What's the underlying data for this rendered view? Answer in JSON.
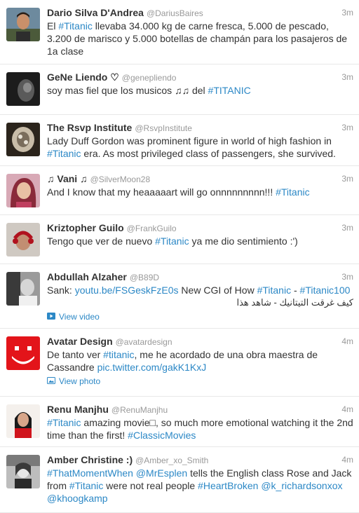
{
  "tweets": [
    {
      "name": "Dario Silva D'Andrea",
      "handle": "@DariusBaires",
      "time": "3m",
      "parts": [
        [
          "El ",
          0
        ],
        [
          "#Titanic",
          1
        ],
        [
          " llevaba 34.000 kg de carne fresca, 5.000 de pescado, 3.200 de marisco y 5.000 botellas de champán para los pasajeros de 1a clase",
          0
        ]
      ]
    },
    {
      "name": "GeNe Liendo ♡",
      "handle": "@geneplie​ndo",
      "time": "3m",
      "parts": [
        [
          "soy mas fiel que los musicos ♫♫ del ",
          0
        ],
        [
          "#TITANIC",
          1
        ]
      ]
    },
    {
      "name": "The Rsvp Institute",
      "handle": "@RsvpInstitute",
      "time": "3m",
      "parts": [
        [
          "Lady Duff Gordon was prominent figure in world of high fashion in ",
          0
        ],
        [
          "#Titanic",
          1
        ],
        [
          " era. As most privileged class of passengers, she survived.",
          0
        ]
      ]
    },
    {
      "name": "♫ Vani ♫",
      "handle": "@SilverMoon28",
      "time": "3m",
      "parts": [
        [
          "And I know that my heaaaaart will go onnnnnnnnn!!! ",
          0
        ],
        [
          "#Titanic",
          1
        ]
      ]
    },
    {
      "name": "Kriztopher Guilo",
      "handle": "@FrankGuilo",
      "time": "3m",
      "parts": [
        [
          "Tengo que ver de nuevo ",
          0
        ],
        [
          "#Titanic",
          1
        ],
        [
          " ya me dio sentimiento :')",
          0
        ]
      ]
    },
    {
      "name": "Abdullah Alzaher",
      "handle": "@B89D",
      "time": "3m",
      "parts": [
        [
          "Sank: ",
          0
        ],
        [
          "youtu.be/FSGeskFzE0s",
          1
        ],
        [
          " New CGI of How ",
          0
        ],
        [
          "#Titanic",
          1
        ],
        [
          " - ",
          0
        ],
        [
          "#Titanic100",
          1
        ]
      ],
      "arabic": "كيف غرقت التيتانيك - شاهد هذا",
      "media_label": "View video",
      "media_icon": "video-icon"
    },
    {
      "name": "Avatar Design",
      "handle": "@avatardesign",
      "time": "4m",
      "parts": [
        [
          "De tanto ver ",
          0
        ],
        [
          "#titanic",
          1
        ],
        [
          ", me he acordado de una obra maestra de Cassandre ",
          0
        ],
        [
          "pic.twitter.com/gakK1KxJ",
          1
        ]
      ],
      "media_label": "View photo",
      "media_icon": "photo-icon"
    },
    {
      "name": "Renu Manjhu",
      "handle": "@RenuManjhu",
      "time": "4m",
      "parts": [
        [
          "#Titanic",
          1
        ],
        [
          " amazing movie□, so much more emotional watching it the 2nd time than the first! ",
          0
        ],
        [
          "#ClassicMovies",
          1
        ]
      ]
    },
    {
      "name": "Amber Christine :)",
      "handle": "@Amber_xo_Smith",
      "time": "4m",
      "parts": [
        [
          "#ThatMomentWhen",
          1
        ],
        [
          " ",
          0
        ],
        [
          "@MrEsplen",
          1
        ],
        [
          " tells the English class Rose and Jack from ",
          0
        ],
        [
          "#Titanic",
          1
        ],
        [
          " were not real people ",
          0
        ],
        [
          "#HeartBroken",
          1
        ],
        [
          " ",
          0
        ],
        [
          "@k_richardsonxox",
          1
        ],
        [
          " ",
          0
        ],
        [
          "@khoogkamp",
          1
        ]
      ]
    }
  ]
}
